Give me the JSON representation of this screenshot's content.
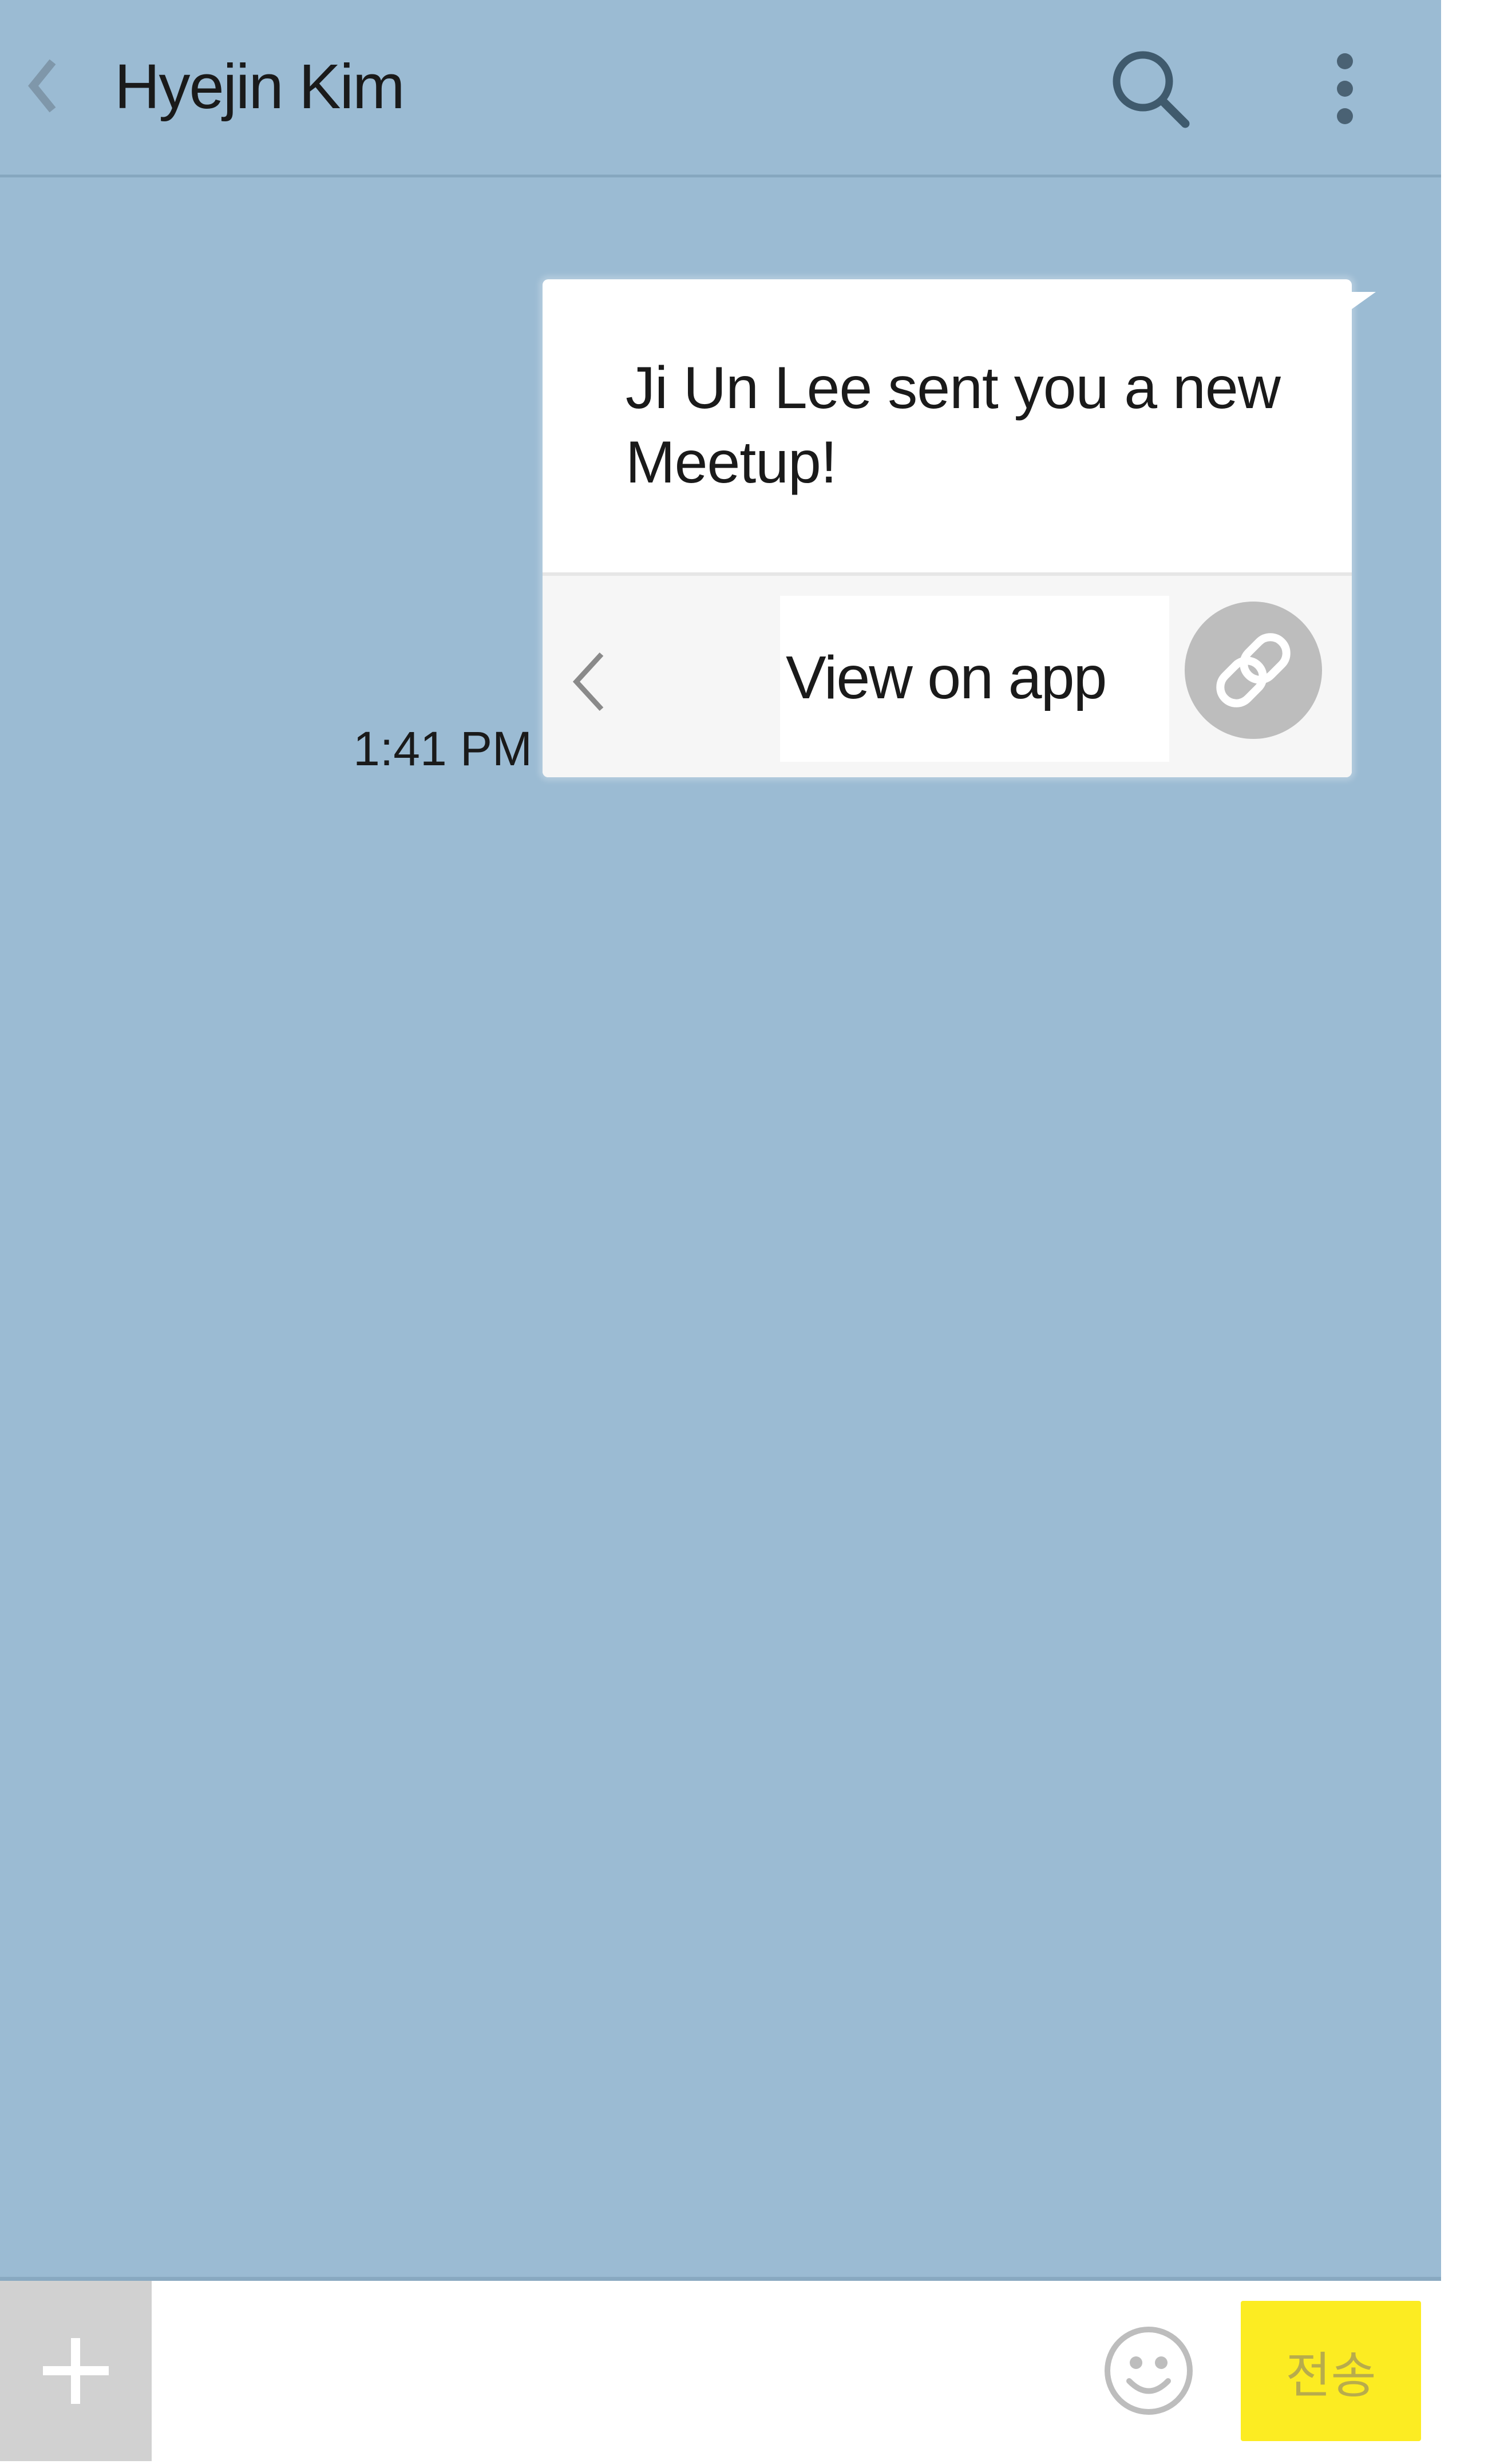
{
  "header": {
    "back_icon": "chevron-left-icon",
    "title": "Hyejin Kim",
    "search_icon": "search-icon",
    "more_icon": "more-vertical-icon"
  },
  "chat": {
    "messages": [
      {
        "time": "1:41 PM",
        "text": "Ji Un Lee sent you a new Meetup!",
        "card": {
          "back_icon": "chevron-left-icon",
          "action_label": "View on app",
          "link_icon": "link-icon"
        }
      }
    ]
  },
  "input_bar": {
    "add_icon": "plus-icon",
    "message_value": "",
    "emoji_icon": "smiley-icon",
    "send_label": "전송"
  },
  "colors": {
    "chat_background": "#9bbbd3",
    "send_button": "#fcec22",
    "send_text": "#b8ac4c",
    "add_button": "#d1d1d1",
    "link_button": "#bdbdbd"
  }
}
